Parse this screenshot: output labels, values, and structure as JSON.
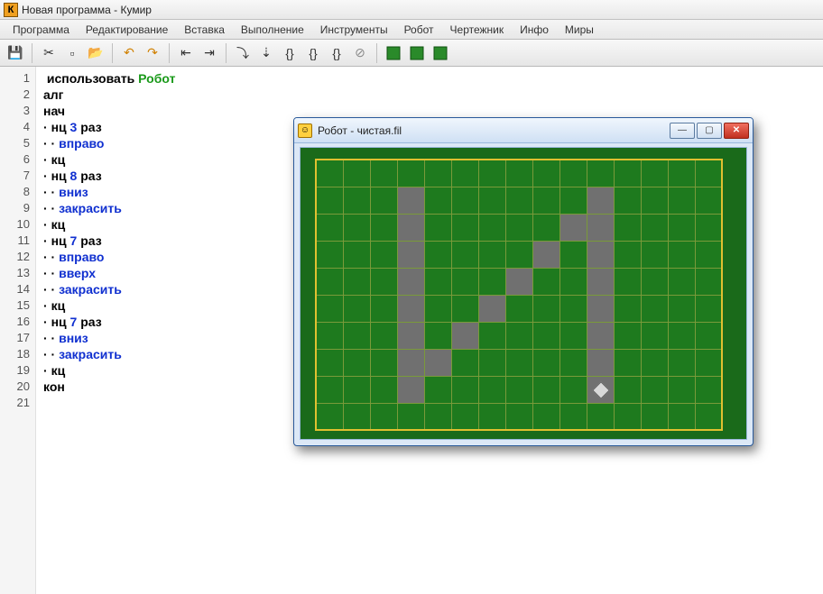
{
  "app": {
    "title": "Новая программа - Кумир",
    "icon_letter": "К"
  },
  "menu": [
    "Программа",
    "Редактирование",
    "Вставка",
    "Выполнение",
    "Инструменты",
    "Робот",
    "Чертежник",
    "Инфо",
    "Миры"
  ],
  "toolbar_icons": [
    "save",
    "cut",
    "new",
    "open",
    "undo",
    "redo",
    "indent-left",
    "indent-right",
    "step-in",
    "step-over",
    "braces1",
    "braces2",
    "braces3",
    "stop",
    "grid1",
    "grid2",
    "grid3"
  ],
  "code": [
    {
      "n": 1,
      "tokens": [
        {
          "t": " ",
          "c": "plain"
        },
        {
          "t": "использовать ",
          "c": "kw-black"
        },
        {
          "t": "Робот",
          "c": "kw-green"
        }
      ]
    },
    {
      "n": 2,
      "tokens": [
        {
          "t": "алг",
          "c": "kw-black"
        }
      ]
    },
    {
      "n": 3,
      "tokens": [
        {
          "t": "нач",
          "c": "kw-black"
        }
      ]
    },
    {
      "n": 4,
      "tokens": [
        {
          "t": "· ",
          "c": "dot"
        },
        {
          "t": "нц ",
          "c": "kw-black"
        },
        {
          "t": "3",
          "c": "kw-blue"
        },
        {
          "t": " раз",
          "c": "kw-black"
        }
      ]
    },
    {
      "n": 5,
      "tokens": [
        {
          "t": "· · ",
          "c": "dot"
        },
        {
          "t": "вправо",
          "c": "kw-bluekw"
        }
      ]
    },
    {
      "n": 6,
      "tokens": [
        {
          "t": "· ",
          "c": "dot"
        },
        {
          "t": "кц",
          "c": "kw-black"
        }
      ]
    },
    {
      "n": 7,
      "tokens": [
        {
          "t": "· ",
          "c": "dot"
        },
        {
          "t": "нц ",
          "c": "kw-black"
        },
        {
          "t": "8",
          "c": "kw-blue"
        },
        {
          "t": " раз",
          "c": "kw-black"
        }
      ]
    },
    {
      "n": 8,
      "tokens": [
        {
          "t": "· · ",
          "c": "dot"
        },
        {
          "t": "вниз",
          "c": "kw-bluekw"
        }
      ]
    },
    {
      "n": 9,
      "tokens": [
        {
          "t": "· · ",
          "c": "dot"
        },
        {
          "t": "закрасить",
          "c": "kw-bluekw"
        }
      ]
    },
    {
      "n": 10,
      "tokens": [
        {
          "t": "· ",
          "c": "dot"
        },
        {
          "t": "кц",
          "c": "kw-black"
        }
      ]
    },
    {
      "n": 11,
      "tokens": [
        {
          "t": "· ",
          "c": "dot"
        },
        {
          "t": "нц ",
          "c": "kw-black"
        },
        {
          "t": "7",
          "c": "kw-blue"
        },
        {
          "t": " раз",
          "c": "kw-black"
        }
      ]
    },
    {
      "n": 12,
      "tokens": [
        {
          "t": "· · ",
          "c": "dot"
        },
        {
          "t": "вправо",
          "c": "kw-bluekw"
        }
      ]
    },
    {
      "n": 13,
      "tokens": [
        {
          "t": "· · ",
          "c": "dot"
        },
        {
          "t": "вверх",
          "c": "kw-bluekw"
        }
      ]
    },
    {
      "n": 14,
      "tokens": [
        {
          "t": "· · ",
          "c": "dot"
        },
        {
          "t": "закрасить",
          "c": "kw-bluekw"
        }
      ]
    },
    {
      "n": 15,
      "tokens": [
        {
          "t": "· ",
          "c": "dot"
        },
        {
          "t": "кц",
          "c": "kw-black"
        }
      ]
    },
    {
      "n": 16,
      "tokens": [
        {
          "t": "· ",
          "c": "dot"
        },
        {
          "t": "нц ",
          "c": "kw-black"
        },
        {
          "t": "7",
          "c": "kw-blue"
        },
        {
          "t": " раз",
          "c": "kw-black"
        }
      ]
    },
    {
      "n": 17,
      "tokens": [
        {
          "t": "· · ",
          "c": "dot"
        },
        {
          "t": "вниз",
          "c": "kw-bluekw"
        }
      ]
    },
    {
      "n": 18,
      "tokens": [
        {
          "t": "· · ",
          "c": "dot"
        },
        {
          "t": "закрасить",
          "c": "kw-bluekw"
        }
      ]
    },
    {
      "n": 19,
      "tokens": [
        {
          "t": "· ",
          "c": "dot"
        },
        {
          "t": "кц",
          "c": "kw-black"
        }
      ]
    },
    {
      "n": 20,
      "tokens": [
        {
          "t": "кон",
          "c": "kw-black"
        }
      ]
    },
    {
      "n": 21,
      "tokens": [
        {
          "t": "",
          "c": "plain"
        }
      ]
    }
  ],
  "robot_window": {
    "title": "Робот - чистая.fil",
    "grid": {
      "cols": 15,
      "rows": 10,
      "cell": 30
    },
    "painted": [
      [
        3,
        1
      ],
      [
        3,
        2
      ],
      [
        3,
        3
      ],
      [
        3,
        4
      ],
      [
        3,
        5
      ],
      [
        3,
        6
      ],
      [
        3,
        7
      ],
      [
        3,
        8
      ],
      [
        4,
        7
      ],
      [
        5,
        6
      ],
      [
        6,
        5
      ],
      [
        7,
        4
      ],
      [
        8,
        3
      ],
      [
        9,
        2
      ],
      [
        10,
        1
      ],
      [
        10,
        2
      ],
      [
        10,
        3
      ],
      [
        10,
        4
      ],
      [
        10,
        5
      ],
      [
        10,
        6
      ],
      [
        10,
        7
      ],
      [
        10,
        8
      ]
    ],
    "robot": {
      "col": 10,
      "row": 8
    }
  }
}
